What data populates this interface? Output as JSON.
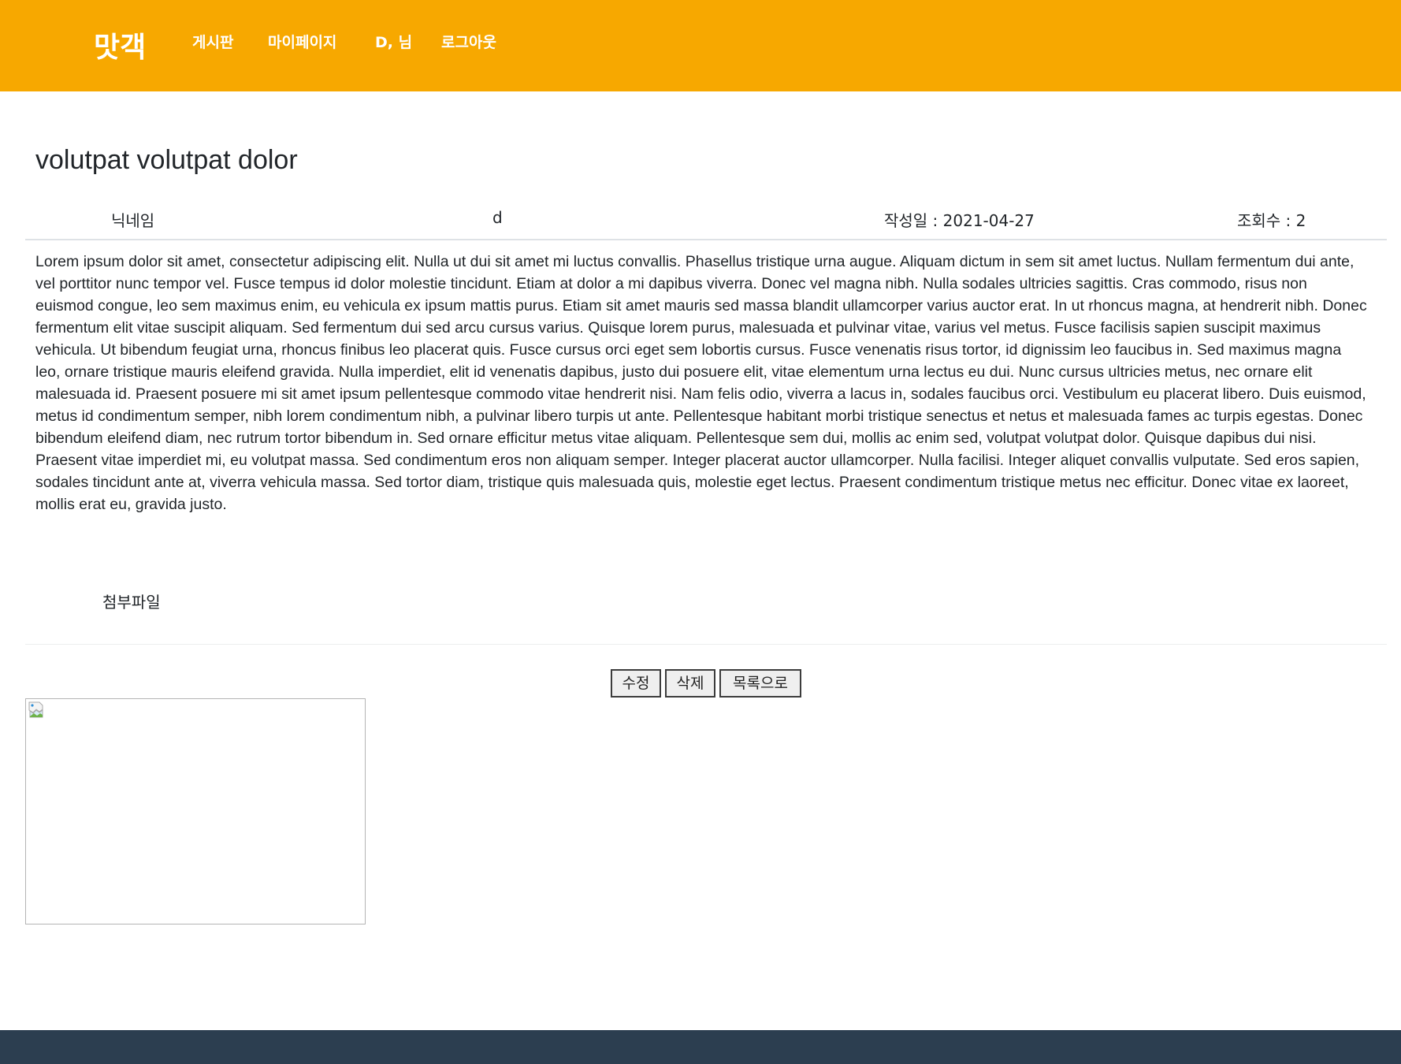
{
  "header": {
    "brand": "맛객",
    "nav": {
      "board": "게시판",
      "mypage": "마이페이지",
      "user": "D, 님",
      "logout": "로그아웃"
    },
    "bg_color": "#f7a800"
  },
  "post": {
    "title": "volutpat volutpat dolor",
    "nickname_label": "닉네임",
    "nickname_value": "d",
    "date": "작성일 : 2021-04-27",
    "views": "조회수 : 2",
    "content": "Lorem ipsum dolor sit amet, consectetur adipiscing elit. Nulla ut dui sit amet mi luctus convallis. Phasellus tristique urna augue. Aliquam dictum in sem sit amet luctus. Nullam fermentum dui ante, vel porttitor nunc tempor vel. Fusce tempus id dolor molestie tincidunt. Etiam at dolor a mi dapibus viverra. Donec vel magna nibh. Nulla sodales ultricies sagittis. Cras commodo, risus non euismod congue, leo sem maximus enim, eu vehicula ex ipsum mattis purus. Etiam sit amet mauris sed massa blandit ullamcorper varius auctor erat. In ut rhoncus magna, at hendrerit nibh. Donec fermentum elit vitae suscipit aliquam. Sed fermentum dui sed arcu cursus varius. Quisque lorem purus, malesuada et pulvinar vitae, varius vel metus. Fusce facilisis sapien suscipit maximus vehicula. Ut bibendum feugiat urna, rhoncus finibus leo placerat quis. Fusce cursus orci eget sem lobortis cursus. Fusce venenatis risus tortor, id dignissim leo faucibus in. Sed maximus magna leo, ornare tristique mauris eleifend gravida. Nulla imperdiet, elit id venenatis dapibus, justo dui posuere elit, vitae elementum urna lectus eu dui. Nunc cursus ultricies metus, nec ornare elit malesuada id. Praesent posuere mi sit amet ipsum pellentesque commodo vitae hendrerit nisi. Nam felis odio, viverra a lacus in, sodales faucibus orci. Vestibulum eu placerat libero. Duis euismod, metus id condimentum semper, nibh lorem condimentum nibh, a pulvinar libero turpis ut ante. Pellentesque habitant morbi tristique senectus et netus et malesuada fames ac turpis egestas. Donec bibendum eleifend diam, nec rutrum tortor bibendum in. Sed ornare efficitur metus vitae aliquam. Pellentesque sem dui, mollis ac enim sed, volutpat volutpat dolor. Quisque dapibus dui nisi. Praesent vitae imperdiet mi, eu volutpat massa. Sed condimentum eros non aliquam semper. Integer placerat auctor ullamcorper. Nulla facilisi. Integer aliquet convallis vulputate. Sed eros sapien, sodales tincidunt ante at, viverra vehicula massa. Sed tortor diam, tristique quis malesuada quis, molestie eget lectus. Praesent condimentum tristique metus nec efficitur. Donec vitae ex laoreet, mollis erat eu, gravida justo.",
    "attachment_label": "첨부파일"
  },
  "actions": {
    "edit": "수정",
    "delete": "삭제",
    "list": "목록으로"
  },
  "image": {
    "icon": "broken-image-icon"
  },
  "footer": {
    "bg_color": "#2c3e50"
  }
}
